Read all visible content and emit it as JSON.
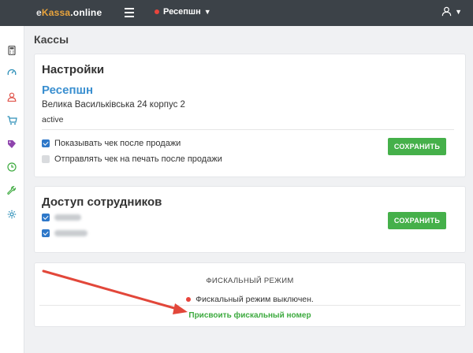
{
  "header": {
    "logo": {
      "part1": "e",
      "part2": "Kassa",
      "part3": ".online"
    },
    "store_selector": "Ресепшн",
    "colors": {
      "bar": "#3c4248",
      "accent": "#e8a33c",
      "status_off": "#e8453c"
    }
  },
  "sidebar": {
    "icons": [
      "calculator-icon",
      "gauge-icon",
      "user-icon",
      "cart-icon",
      "tag-icon",
      "clock-icon",
      "wrench-icon",
      "gear-icon"
    ]
  },
  "page": {
    "title": "Кассы"
  },
  "settings": {
    "title": "Настройки",
    "store_name": "Ресепшн",
    "address": "Велика Васильківська 24 корпус 2",
    "status": "active",
    "options": [
      {
        "label": "Показывать чек после продажи",
        "checked": true
      },
      {
        "label": "Отправлять чек на печать после продажи",
        "checked": false
      }
    ],
    "save_label": "СОХРАНИТЬ"
  },
  "access": {
    "title": "Доступ сотрудников",
    "employees": [
      {
        "checked": true
      },
      {
        "checked": true
      }
    ],
    "save_label": "СОХРАНИТЬ"
  },
  "fiscal": {
    "heading": "ФИСКАЛЬНЫЙ РЕЖИМ",
    "status": "Фискальный режим выключен.",
    "link_label": "Присвоить фискальный номер"
  }
}
